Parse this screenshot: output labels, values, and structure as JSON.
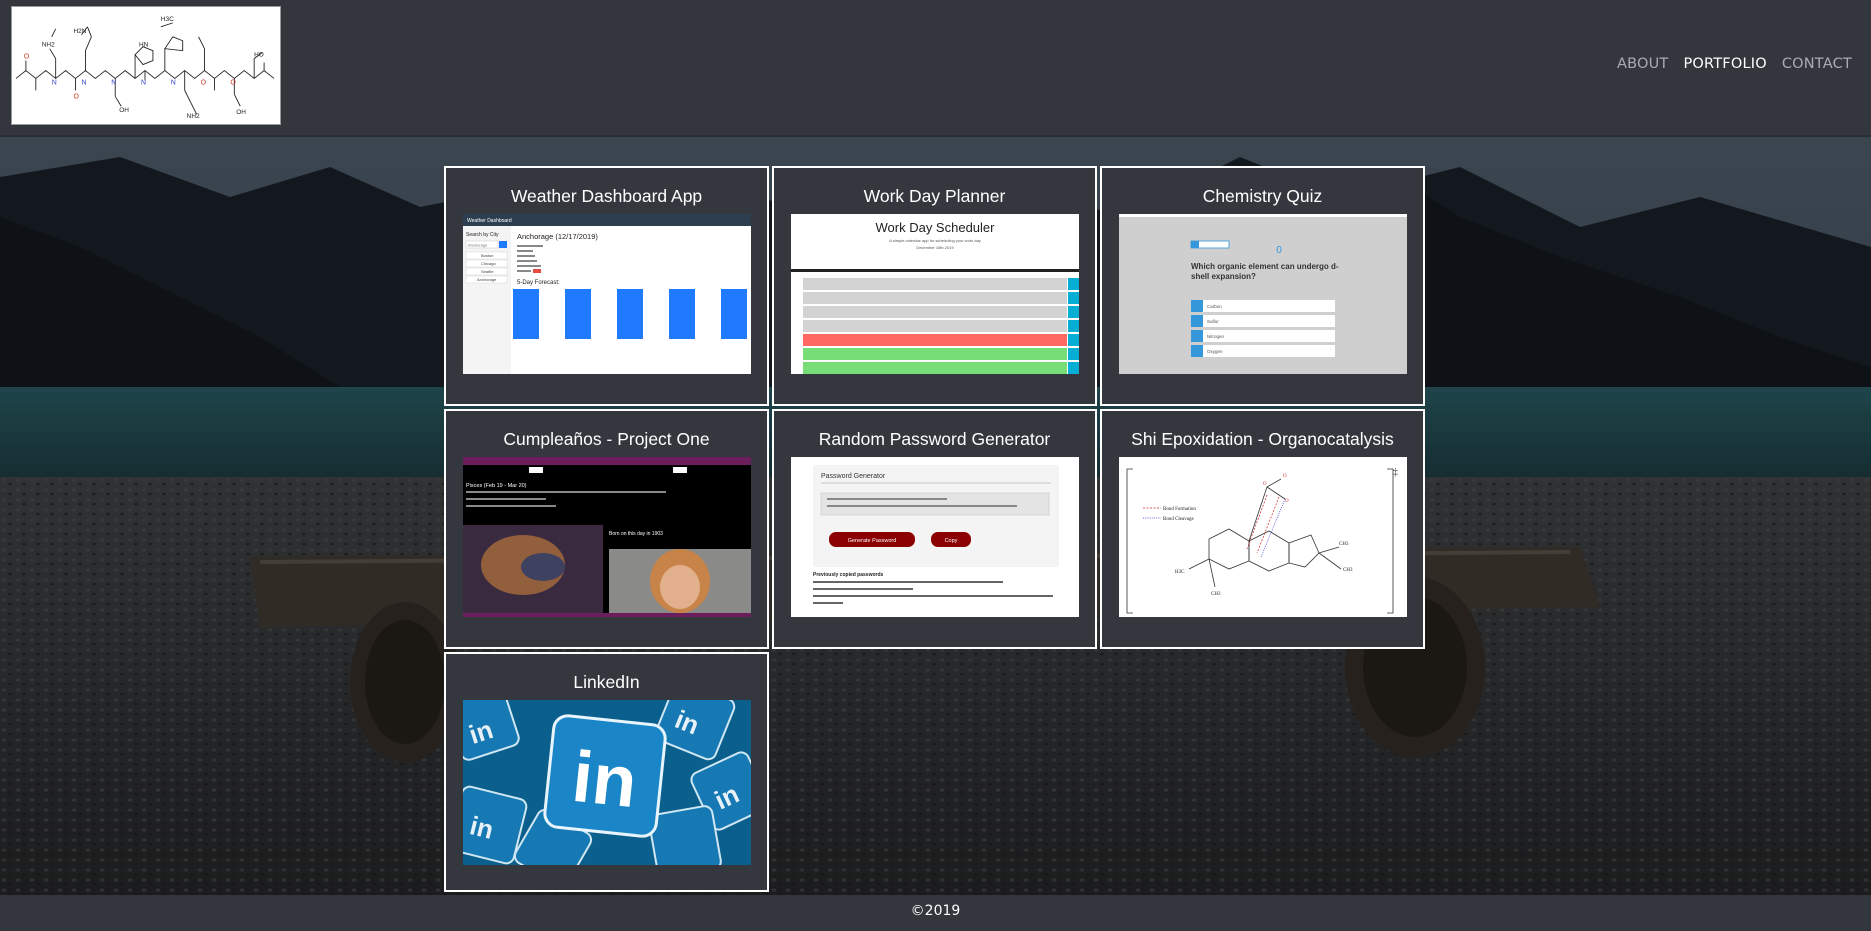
{
  "header": {
    "logo_alt": "peptide structure logo",
    "nav": [
      {
        "label": "ABOUT",
        "active": false
      },
      {
        "label": "PORTFOLIO",
        "active": true
      },
      {
        "label": "CONTACT",
        "active": false
      }
    ]
  },
  "portfolio": {
    "cards": [
      {
        "title": "Weather Dashboard App",
        "thumb": {
          "app_name": "Weather Dashboard",
          "search_label": "Search by City",
          "search_value": "Anchorage",
          "city_heading": "Anchorage (12/17/2019)",
          "forecast_heading": "5-Day Forecast:",
          "cities": [
            "Boston",
            "Chicago",
            "Seattle",
            "Anchorage"
          ]
        }
      },
      {
        "title": "Work Day Planner",
        "thumb": {
          "heading": "Work Day Scheduler",
          "subheading": "A simple calendar app for scheduling your work day",
          "date": "December 16th 2019"
        }
      },
      {
        "title": "Chemistry Quiz",
        "thumb": {
          "question": "Which organic element can undergo d-shell expansion?",
          "score": "0",
          "answers": [
            "Carbon",
            "Sulfur",
            "Nitrogen",
            "Oxygen"
          ]
        }
      },
      {
        "title": "Cumpleaños - Project One",
        "thumb": {
          "heading": "Pisces (Feb 19 - Mar 20)",
          "born_text": "Born on this day in 1903"
        }
      },
      {
        "title": "Random Password Generator",
        "thumb": {
          "heading": "Password Generator",
          "generate_label": "Generate Password",
          "copy_label": "Copy",
          "previous_label": "Previously copied passwords"
        }
      },
      {
        "title": "Shi Epoxidation - Organocatalysis",
        "thumb": {
          "legend": [
            "Bond Formation",
            "Bond Cleavage"
          ]
        }
      },
      {
        "title": "LinkedIn",
        "thumb": {
          "logo_text": "in"
        }
      }
    ]
  },
  "footer": {
    "copyright": "©2019"
  },
  "colors": {
    "header_bg": "#33363d",
    "card_bg": "#34373e",
    "card_border": "#ffffff",
    "nav_inactive": "#a9acb3",
    "nav_active": "#ffffff",
    "linkedin_blue": "#0e76a8"
  }
}
